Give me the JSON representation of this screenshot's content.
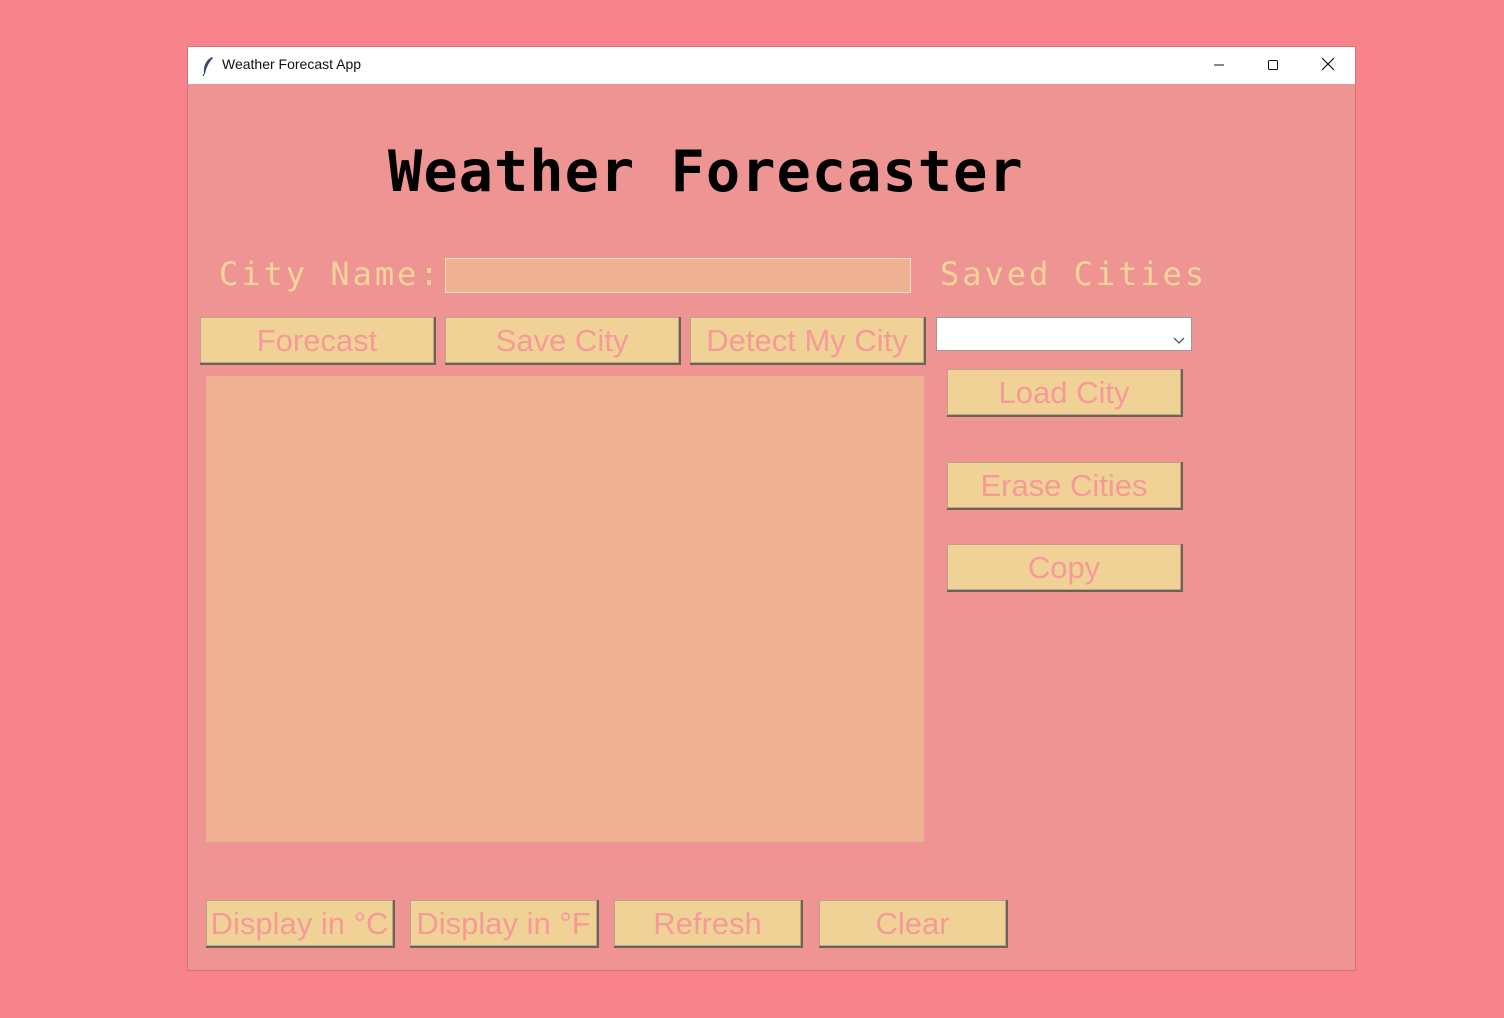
{
  "window": {
    "title": "Weather Forecast App",
    "icon": "feather-icon",
    "controls": [
      "minimize-icon",
      "maximize-icon",
      "close-icon"
    ]
  },
  "main": {
    "heading": "Weather Forecaster",
    "city_label": "City Name:",
    "city_input_value": "",
    "saved_label": "Saved Cities",
    "saved_select_value": "",
    "output_text": ""
  },
  "buttons": {
    "forecast": "Forecast",
    "save_city": "Save City",
    "detect_city": "Detect My City",
    "load_city": "Load City",
    "erase_cities": "Erase Cities",
    "copy": "Copy",
    "display_c": "Display in °C",
    "display_f": "Display in °F",
    "refresh": "Refresh",
    "clear": "Clear"
  },
  "colors": {
    "page_bg": "#f7848a",
    "window_bg": "#ee9594",
    "button_bg": "#f1d296",
    "button_text": "#f69a99",
    "label_text": "#f2d49a",
    "input_bg": "#eeb293"
  }
}
